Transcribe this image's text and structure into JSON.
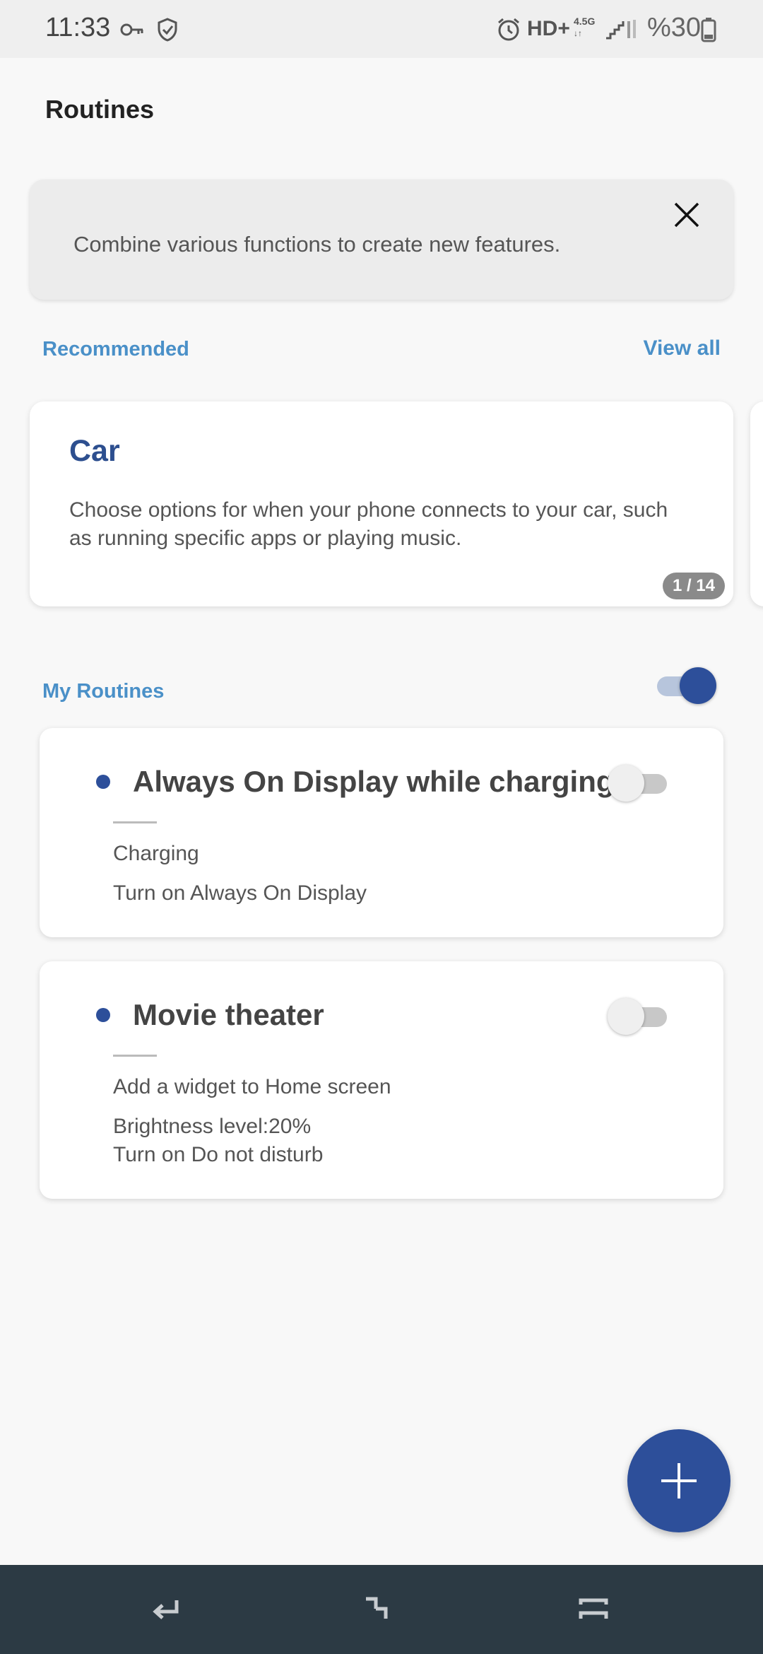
{
  "status_bar": {
    "time": "11:33",
    "hd_label": "HD+",
    "network_label": "4.5G",
    "battery_text": "%30",
    "icons": [
      "key-icon",
      "shield-icon",
      "alarm-icon",
      "signal-icon",
      "battery-icon"
    ]
  },
  "header": {
    "title": "Routines"
  },
  "banner": {
    "text": "Combine various functions to create new features."
  },
  "recommended": {
    "label": "Recommended",
    "view_all": "View all",
    "card": {
      "title": "Car",
      "description": "Choose options for when your phone connects to your car, such as running specific apps or playing music.",
      "pager": "1 / 14"
    }
  },
  "my_routines": {
    "label": "My Routines",
    "master_toggle_on": true,
    "items": [
      {
        "name": "Always On Display while charging",
        "enabled": false,
        "details": [
          "Charging",
          "Turn on Always On Display"
        ]
      },
      {
        "name": "Movie theater",
        "enabled": false,
        "details": [
          "Add a widget to Home screen",
          "Brightness level:20%",
          "Turn on Do not disturb"
        ]
      }
    ]
  },
  "colors": {
    "accent": "#2d4f9a",
    "link": "#4a90c8",
    "navbar": "#2c3a44"
  }
}
